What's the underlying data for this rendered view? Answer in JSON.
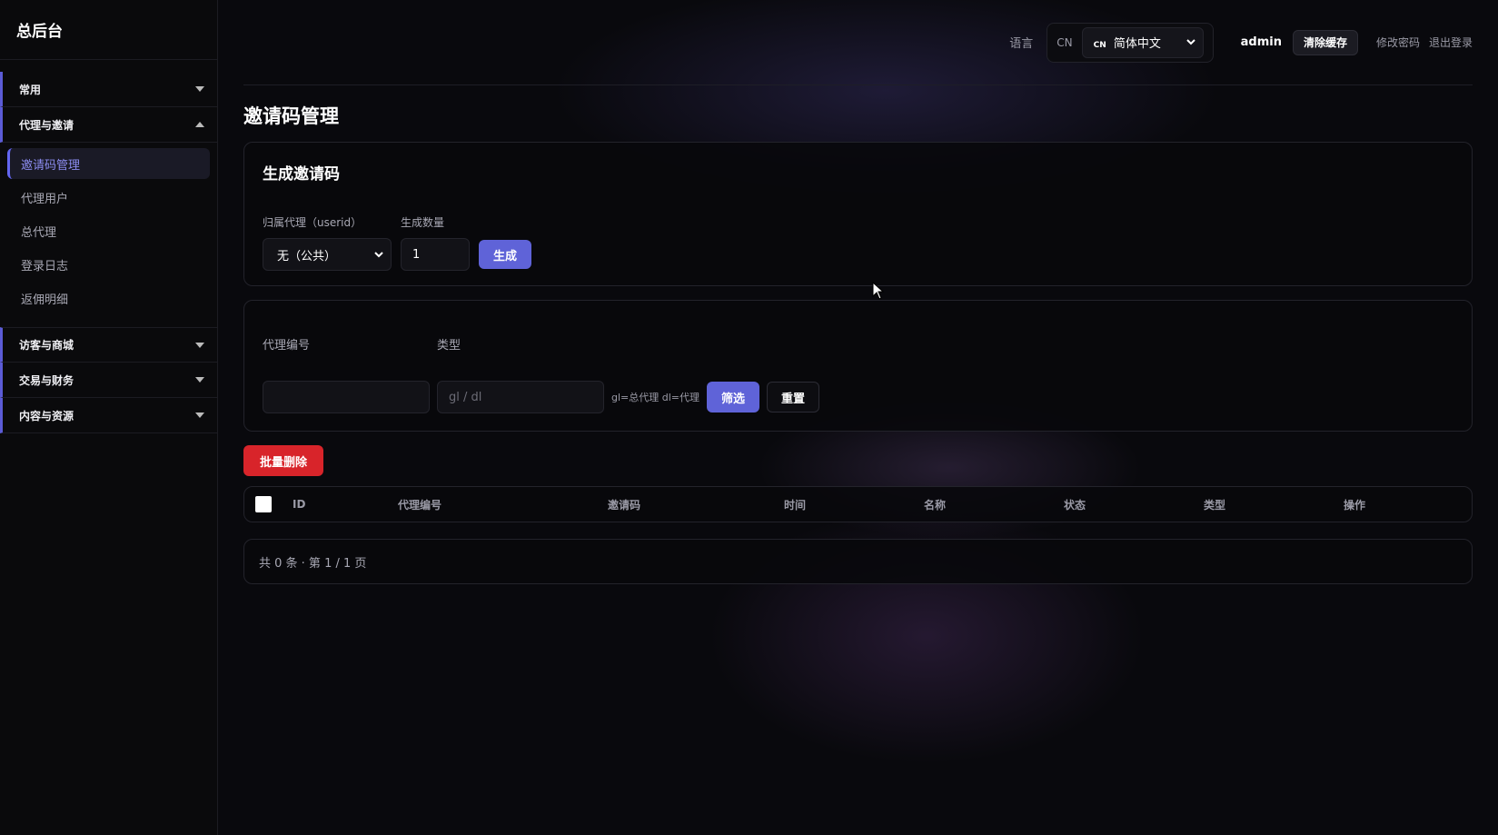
{
  "sidebar": {
    "brand": "总后台",
    "groups": [
      {
        "label": "常用"
      },
      {
        "label": "代理与邀请",
        "items": [
          "邀请码管理",
          "代理用户",
          "总代理",
          "登录日志",
          "返佣明细"
        ]
      },
      {
        "label": "访客与商城"
      },
      {
        "label": "交易与财务"
      },
      {
        "label": "内容与资源"
      }
    ]
  },
  "header": {
    "language_label": "语言",
    "language_code": "CN",
    "language_flag": "CN",
    "language_value": "简体中文",
    "user": "admin",
    "clear_cache": "清除缓存",
    "change_password": "修改密码",
    "logout": "退出登录"
  },
  "page": {
    "title": "邀请码管理"
  },
  "generate": {
    "title": "生成邀请码",
    "agent_label": "归属代理（userid）",
    "agent_value": "无（公共）",
    "count_label": "生成数量",
    "count_value": "1",
    "submit": "生成"
  },
  "filter": {
    "agent_no_label": "代理编号",
    "type_label": "类型",
    "type_placeholder": "gl / dl",
    "hint": "gl=总代理 dl=代理",
    "filter_btn": "筛选",
    "reset_btn": "重置"
  },
  "batch_delete": "批量删除",
  "table": {
    "columns": [
      "ID",
      "代理编号",
      "邀请码",
      "时间",
      "名称",
      "状态",
      "类型",
      "操作"
    ]
  },
  "pagination": {
    "summary": "共 0 条 · 第 1 / 1 页"
  }
}
